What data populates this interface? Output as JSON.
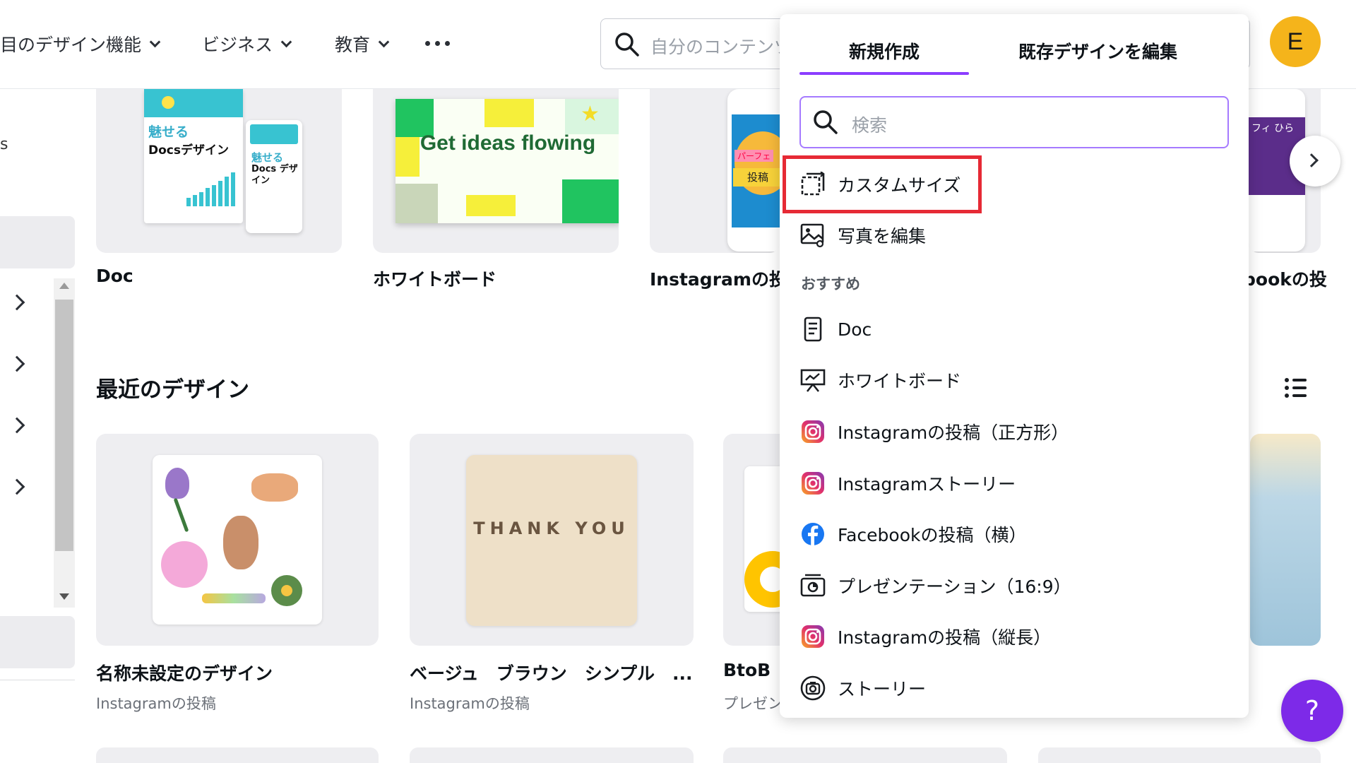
{
  "nav": {
    "items": [
      {
        "label": "目のデザイン機能"
      },
      {
        "label": "ビジネス"
      },
      {
        "label": "教育"
      }
    ],
    "search_placeholder": "自分のコンテンツ",
    "avatar_initial": "E"
  },
  "sidebar": {
    "partial_text": "s"
  },
  "templates": [
    {
      "label": "Doc",
      "thumb_text_1": "魅せる",
      "thumb_text_2": "Docsデザイン",
      "thumb_small_1": "魅せる",
      "thumb_small_2": "Docs デザイン"
    },
    {
      "label": "ホワイトボード",
      "thumb_text": "Get ideas flowing"
    },
    {
      "label": "Instagramの投稿",
      "thumb_tag": "投稿",
      "thumb_tag2": "パーフェ"
    },
    {
      "label": "bookの投",
      "thumb_text": "フィ ひら"
    }
  ],
  "recent": {
    "title": "最近のデザイン",
    "items": [
      {
        "name": "名称未設定のデザイン",
        "type": "Instagramの投稿"
      },
      {
        "name": "ベージュ　ブラウン　シンプル　...",
        "type": "Instagramの投稿",
        "thumb_text": "THANK YOU"
      },
      {
        "name": "BtoB",
        "type": "プレゼン"
      }
    ]
  },
  "panel": {
    "tabs": [
      "新規作成",
      "既存デザインを編集"
    ],
    "active_tab": "新規作成",
    "search_placeholder": "検索",
    "actions": [
      {
        "label": "カスタムサイズ",
        "icon": "custom-size-icon",
        "highlighted": true
      },
      {
        "label": "写真を編集",
        "icon": "photo-edit-icon"
      }
    ],
    "group_label": "おすすめ",
    "recommended": [
      {
        "label": "Doc",
        "icon": "doc-icon"
      },
      {
        "label": "ホワイトボード",
        "icon": "whiteboard-icon"
      },
      {
        "label": "Instagramの投稿（正方形）",
        "icon": "instagram-icon"
      },
      {
        "label": "Instagramストーリー",
        "icon": "instagram-icon"
      },
      {
        "label": "Facebookの投稿（横）",
        "icon": "facebook-icon"
      },
      {
        "label": "プレゼンテーション（16:9）",
        "icon": "presentation-icon"
      },
      {
        "label": "Instagramの投稿（縦長）",
        "icon": "instagram-icon"
      },
      {
        "label": "ストーリー",
        "icon": "story-icon"
      }
    ]
  },
  "help": {
    "label": "?"
  },
  "colors": {
    "accent": "#8b3dff",
    "highlight": "#e62a35",
    "avatar": "#f5b41b",
    "help": "#7d2ae8"
  }
}
